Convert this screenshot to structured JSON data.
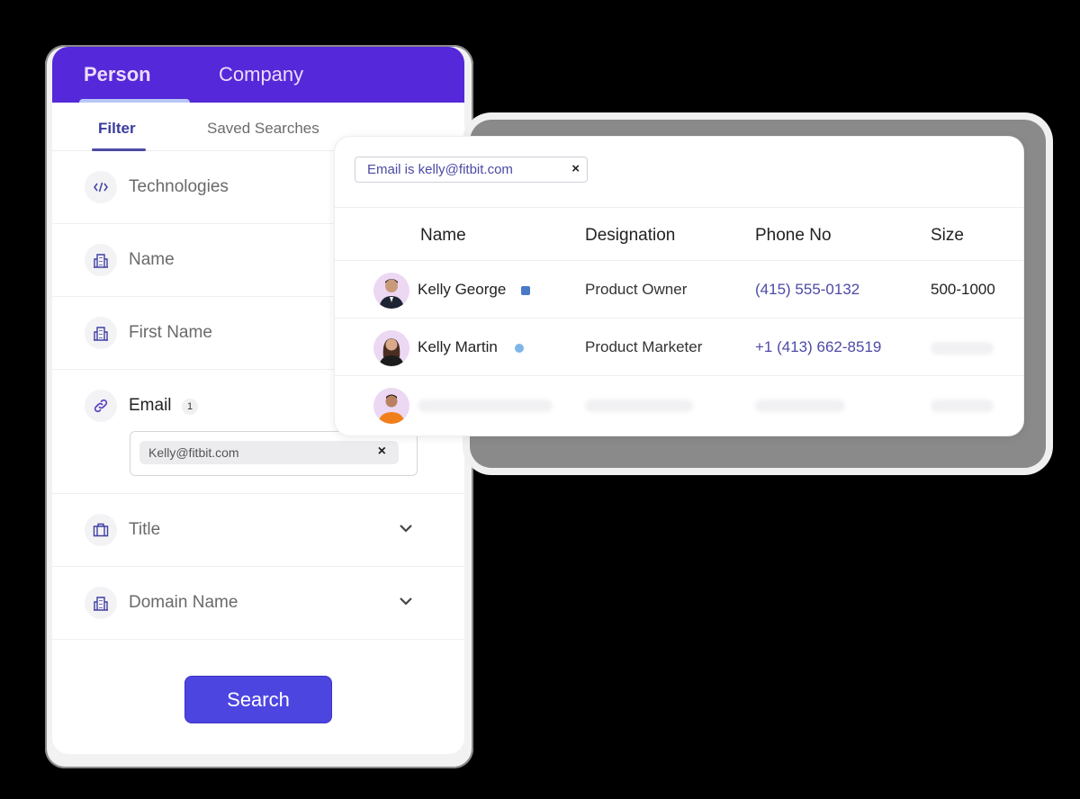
{
  "filter_panel": {
    "top_tabs": [
      {
        "label": "Person",
        "active": true
      },
      {
        "label": "Company",
        "active": false
      }
    ],
    "sub_tabs": [
      {
        "label": "Filter",
        "active": true
      },
      {
        "label": "Saved Searches",
        "active": false
      }
    ],
    "filters": [
      {
        "label": "Technologies",
        "icon": "code-icon"
      },
      {
        "label": "Name",
        "icon": "building-icon"
      },
      {
        "label": "First Name",
        "icon": "building-icon"
      },
      {
        "label": "Email",
        "icon": "link-icon",
        "count": "1",
        "chip_value": "Kelly@fitbit.com",
        "chip_remove": "×"
      },
      {
        "label": "Title",
        "icon": "briefcase-icon",
        "expandable": true
      },
      {
        "label": "Domain Name",
        "icon": "building-icon",
        "expandable": true
      }
    ],
    "search_button": "Search",
    "colors": {
      "header": "#5528d9",
      "accent": "#4d45e0"
    }
  },
  "results": {
    "active_filter": "Email is kelly@fitbit.com",
    "active_filter_remove": "×",
    "columns": [
      "Name",
      "Designation",
      "Phone No",
      "Size"
    ],
    "rows": [
      {
        "name": "Kelly George",
        "social": "linkedin-icon",
        "designation": "Product Owner",
        "phone": "(415) 555-0132",
        "size": "500-1000"
      },
      {
        "name": "Kelly Martin",
        "social": "twitter-icon",
        "designation": "Product Marketer",
        "phone": "+1 (413) 662-8519",
        "size": ""
      },
      {
        "name": "",
        "social": "",
        "designation": "",
        "phone": "",
        "size": ""
      }
    ],
    "colors": {
      "phone": "#4c4aa5"
    }
  }
}
